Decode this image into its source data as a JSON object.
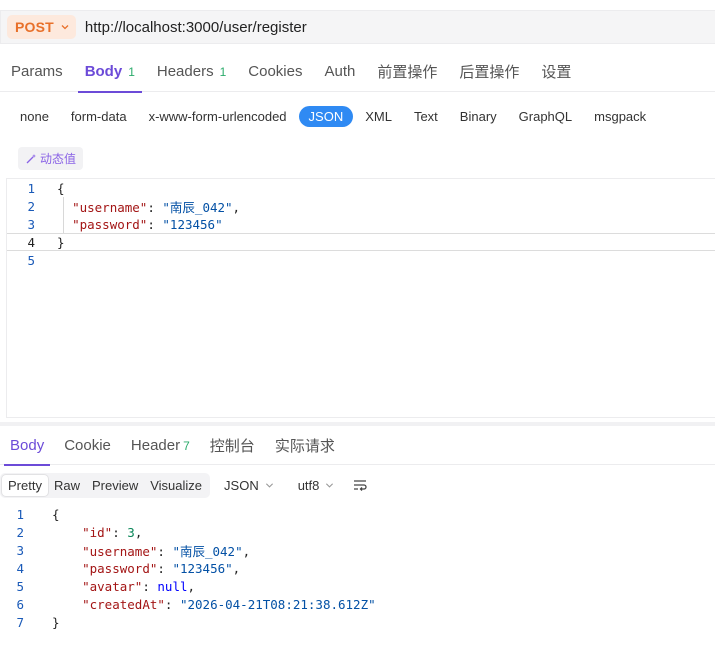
{
  "request": {
    "method": "POST",
    "url": "http://localhost:3000/user/register",
    "tabs": [
      {
        "label": "Params",
        "count": ""
      },
      {
        "label": "Body",
        "count": "1"
      },
      {
        "label": "Headers",
        "count": "1"
      },
      {
        "label": "Cookies",
        "count": ""
      },
      {
        "label": "Auth",
        "count": ""
      },
      {
        "label": "前置操作",
        "count": ""
      },
      {
        "label": "后置操作",
        "count": ""
      },
      {
        "label": "设置",
        "count": ""
      }
    ],
    "active_tab": "Body",
    "body_types": [
      "none",
      "form-data",
      "x-www-form-urlencoded",
      "JSON",
      "XML",
      "Text",
      "Binary",
      "GraphQL",
      "msgpack"
    ],
    "active_body_type": "JSON",
    "dynamic_value_label": "动态值",
    "body_lines": [
      {
        "n": "1",
        "text": "{"
      },
      {
        "n": "2",
        "key": "\"username\"",
        "value": "\"南辰_042\"",
        "tail": ","
      },
      {
        "n": "3",
        "key": "\"password\"",
        "value": "\"123456\"",
        "tail": ""
      },
      {
        "n": "4",
        "text": "}"
      },
      {
        "n": "5",
        "text": ""
      }
    ]
  },
  "response": {
    "tabs": [
      {
        "label": "Body",
        "count": ""
      },
      {
        "label": "Cookie",
        "count": ""
      },
      {
        "label": "Header",
        "count": "7"
      },
      {
        "label": "控制台",
        "count": ""
      },
      {
        "label": "实际请求",
        "count": ""
      }
    ],
    "active_tab": "Body",
    "view_modes": [
      "Pretty",
      "Raw",
      "Preview",
      "Visualize"
    ],
    "active_view_mode": "Pretty",
    "format": "JSON",
    "encoding": "utf8",
    "lines": [
      {
        "n": "1",
        "text": "{"
      },
      {
        "n": "2",
        "key": "\"id\"",
        "value": "3",
        "vtype": "n",
        "tail": ","
      },
      {
        "n": "3",
        "key": "\"username\"",
        "value": "\"南辰_042\"",
        "vtype": "s",
        "tail": ","
      },
      {
        "n": "4",
        "key": "\"password\"",
        "value": "\"123456\"",
        "vtype": "s",
        "tail": ","
      },
      {
        "n": "5",
        "key": "\"avatar\"",
        "value": "null",
        "vtype": "kw",
        "tail": ","
      },
      {
        "n": "6",
        "key": "\"createdAt\"",
        "value": "\"2026-04-21T08:21:38.612Z\"",
        "vtype": "s",
        "tail": ""
      },
      {
        "n": "7",
        "text": "}"
      }
    ]
  },
  "colors": {
    "accent": "#6c4bd8",
    "method": "#e8702a",
    "json_active": "#2f8af3",
    "count": "#2bab6b"
  }
}
